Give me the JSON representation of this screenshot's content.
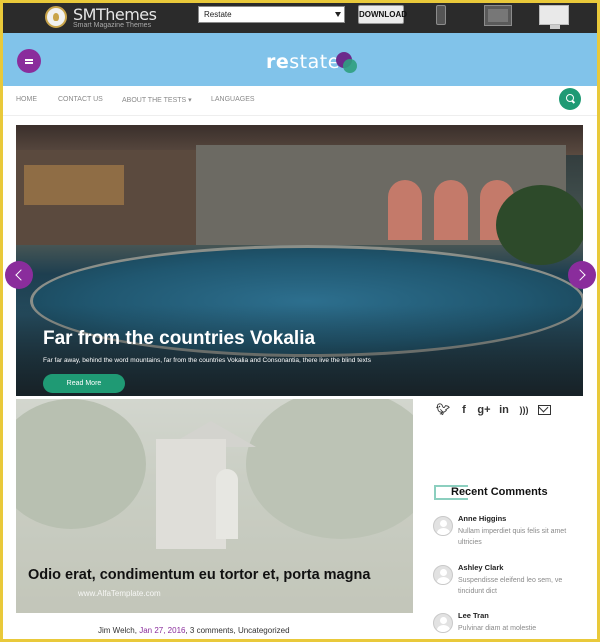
{
  "demo_bar": {
    "brand": "SMThemes",
    "tagline": "Smart Magazine Themes",
    "theme_select_value": "Restate",
    "download_label": "DOWNLOAD",
    "preview_devices": [
      "phone-icon",
      "tablet-icon",
      "desktop-icon"
    ]
  },
  "header": {
    "logo_bold": "re",
    "logo_light": "state",
    "colors": {
      "header_bg": "#81c3ea",
      "accent_purple": "#8a2d9c",
      "accent_green": "#1f9a74"
    }
  },
  "nav": {
    "items": [
      "HOME",
      "CONTACT US",
      "ABOUT THE TESTS ▾",
      "LANGUAGES"
    ]
  },
  "hero": {
    "title": "Far from the countries Vokalia",
    "text": "Far far away, behind the word mountains, far from the countries Vokalia and Consonantia, there live the blind texts",
    "button": "Read More"
  },
  "post": {
    "title": "Odio erat, condimentum eu tortor et, porta magna",
    "watermark": "www.AlfaTemplate.com",
    "author": "Jim Welch",
    "date": "Jan 27, 2016",
    "comments": "3 comments",
    "category": "Uncategorized"
  },
  "sidebar": {
    "social": [
      "twitter-icon",
      "facebook-icon",
      "google-plus-icon",
      "linkedin-icon",
      "rss-icon",
      "mail-icon"
    ],
    "recent_comments_title": "Recent Comments",
    "comments": [
      {
        "name": "Anne Higgins",
        "text": "Nullam imperdiet quis felis sit amet ultricies"
      },
      {
        "name": "Ashley Clark",
        "text": "Suspendisse eleifend leo sem, ve tincidunt dict"
      },
      {
        "name": "Lee Tran",
        "text": "Pulvinar diam at molestie"
      }
    ]
  }
}
